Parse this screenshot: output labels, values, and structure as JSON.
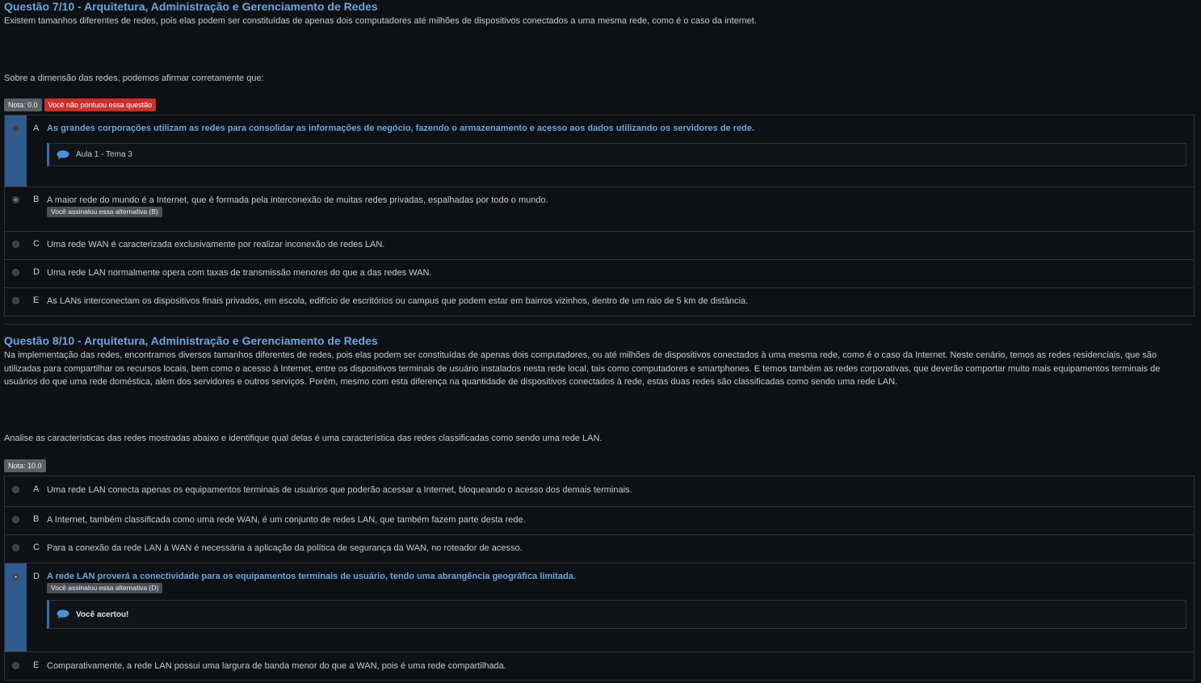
{
  "q7": {
    "title": "Questão 7/10 - Arquitetura, Administração e Gerenciamento de Redes",
    "intro": "Existem tamanhos diferentes de redes, pois elas podem ser constituídas de apenas dois computadores até milhões de dispositivos conectados a uma mesma rede, como é o caso da internet.",
    "prompt": "Sobre a dimensão das redes, podemos afirmar corretamente que:",
    "grade": "Nota: 0.0",
    "status": "Você não pontuou essa questão",
    "options": [
      {
        "letter": "A",
        "text": "As grandes corporações utilizam as redes para consolidar as informações de negócio, fazendo o armazenamento e acesso aos dados utilizando os servidores de rede.",
        "feedback": "Aula 1 - Tema 3"
      },
      {
        "letter": "B",
        "text": "A maior rede do mundo é a Internet, que é formada pela interconexão de muitas redes privadas, espalhadas por todo o mundo.",
        "marked": "Você assinalou essa alternativa (B)"
      },
      {
        "letter": "C",
        "text": "Uma rede WAN é caracterizada exclusivamente por realizar inconexão de redes LAN."
      },
      {
        "letter": "D",
        "text": "Uma rede LAN normalmente opera com taxas de transmissão menores do que a das redes WAN."
      },
      {
        "letter": "E",
        "text": "As LANs interconectam os dispositivos finais privados, em escola, edifício de escritórios ou campus que podem estar em bairros vizinhos, dentro de um raio de 5 km de distância."
      }
    ]
  },
  "q8": {
    "title": "Questão 8/10 - Arquitetura, Administração e Gerenciamento de Redes",
    "intro": "Na implementação das redes, encontramos diversos tamanhos diferentes de redes, pois elas podem ser constituídas de apenas dois computadores, ou até milhões de dispositivos conectados à uma mesma rede, como é o caso da Internet. Neste cenário, temos as redes residenciais, que são utilizadas para compartilhar os recursos locais, bem como o acesso à Internet, entre os dispositivos terminais de usuário instalados nesta rede local, tais como computadores e smartphones. E temos também as redes corporativas, que deverão comportar muito mais equipamentos terminais de usuários do que uma rede doméstica, além dos servidores e outros serviços. Porém, mesmo com esta diferença na quantidade de dispositivos conectados à rede, estas duas redes são classificadas como sendo uma rede LAN.",
    "prompt": "Analise as características das redes mostradas abaixo e identifique qual delas é uma característica das redes classificadas como sendo uma rede LAN.",
    "grade": "Nota: 10.0",
    "options": [
      {
        "letter": "A",
        "text": "Uma rede LAN conecta apenas os equipamentos terminais de usuários que poderão acessar a Internet, bloqueando o acesso dos demais terminais."
      },
      {
        "letter": "B",
        "text": "A Internet, também classificada como uma rede WAN, é um conjunto de redes LAN, que também fazem parte desta rede."
      },
      {
        "letter": "C",
        "text": "Para a conexão da rede LAN à WAN é necessária a aplicação da política de segurança da WAN, no roteador de acesso."
      },
      {
        "letter": "D",
        "text": "A rede LAN proverá a conectividade para os equipamentos terminais de usuário, tendo uma abrangência geográfica limitada.",
        "marked": "Você assinalou essa alternativa (D)",
        "feedback": "Você acertou!"
      },
      {
        "letter": "E",
        "text": "Comparativamente, a rede LAN possui uma largura de banda menor do que a WAN, pois é uma rede compartilhada."
      }
    ]
  },
  "icons": {
    "feedback": "speech-bubble-icon"
  },
  "colors": {
    "accent": "#6ea6dc",
    "selected_bar": "#2f5b8f",
    "error_badge": "#c9302c"
  }
}
